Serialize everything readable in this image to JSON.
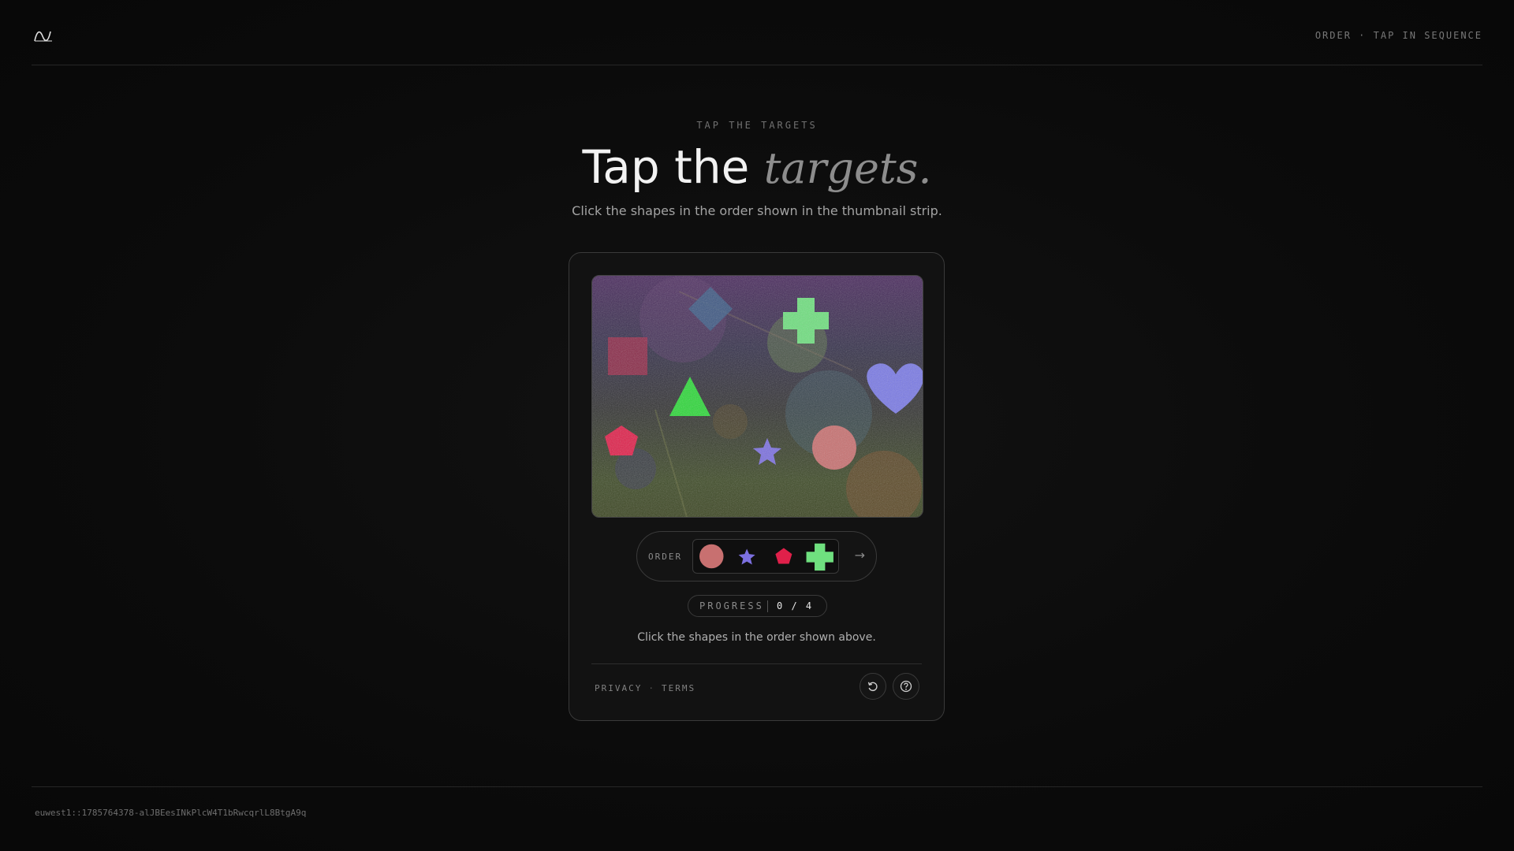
{
  "header": {
    "logo_icon": "wave-logo-icon",
    "right_label": "ORDER · TAP IN SEQUENCE"
  },
  "hero": {
    "eyebrow": "TAP THE TARGETS",
    "title_main": "Tap the ",
    "title_accent": "targets.",
    "subtitle": "Click the shapes in the order shown in the thumbnail strip."
  },
  "challenge": {
    "canvas_shapes": [
      "diamond",
      "cross",
      "square",
      "triangle",
      "heart",
      "pentagon",
      "star",
      "circle"
    ],
    "order_label": "ORDER",
    "order_sequence": [
      "circle",
      "star",
      "pentagon",
      "cross"
    ],
    "order_arrow_icon": "arrow-right-icon",
    "progress_label": "PROGRESS",
    "progress_value": "0 / 4",
    "hint": "Click the shapes in the order shown above."
  },
  "footer": {
    "privacy": "PRIVACY",
    "separator": "·",
    "terms": "TERMS",
    "refresh_icon": "refresh-icon",
    "help_icon": "help-icon"
  },
  "session_id": "euwest1::1785764378-alJBEesINkPlcW4T1bRwcqrlL8BtgA9q",
  "colors": {
    "background": "#0b0b0b",
    "card_border": "#3a3a3a",
    "cross_green": "#6fe07f",
    "triangle_green": "#2ed83a",
    "pentagon_red": "#e0204a",
    "circle_pink": "#c87070",
    "star_purple": "#7c70e0",
    "heart_purple": "#7a7ae6"
  }
}
